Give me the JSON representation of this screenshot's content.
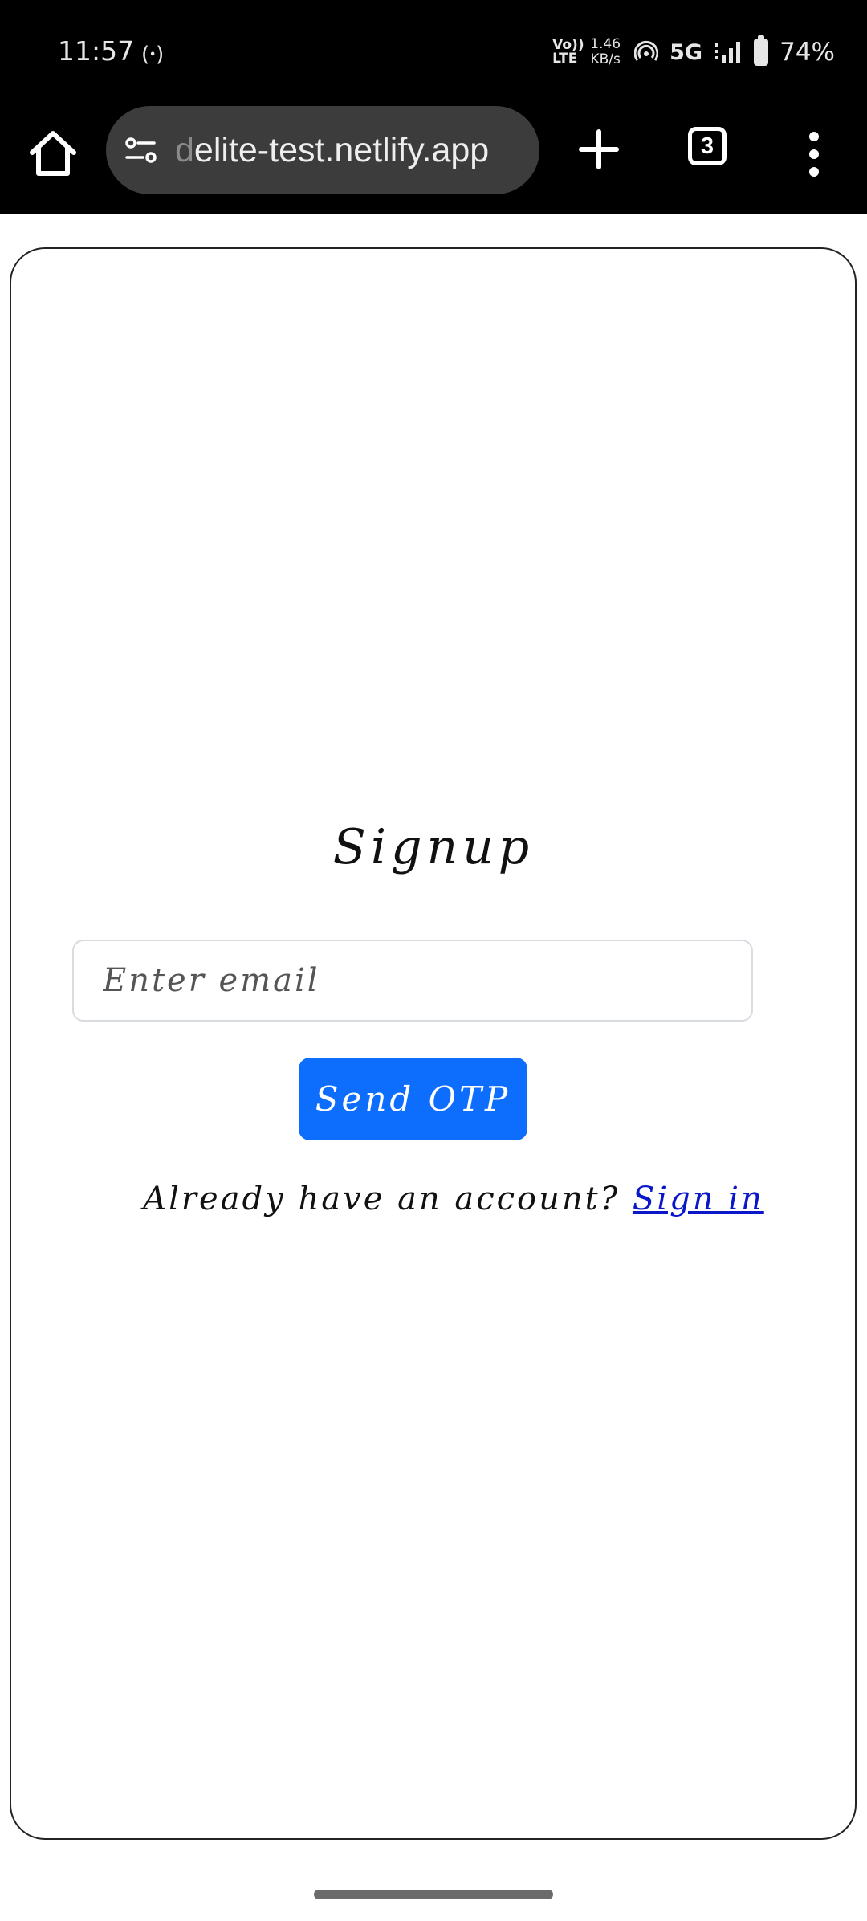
{
  "status_bar": {
    "time": "11:57",
    "hotspot_glyph": "(ꞏ)",
    "volte_top": "Vo))",
    "volte_bottom": "LTE",
    "speed_value": "1.46",
    "speed_unit": "KB/s",
    "network": "5G",
    "battery": "74%"
  },
  "browser": {
    "url_faded": "d",
    "url_rest": "elite-test.netlify.app",
    "tab_count": "3"
  },
  "page": {
    "title": "Signup",
    "email_placeholder": "Enter email",
    "send_button": "Send OTP",
    "signin_prompt": "Already have an account? ",
    "signin_link": "Sign in"
  },
  "colors": {
    "primary_button": "#0d6efd",
    "link": "#0a17c8",
    "chrome_bar": "#000000",
    "url_pill": "#3c3c3c"
  }
}
